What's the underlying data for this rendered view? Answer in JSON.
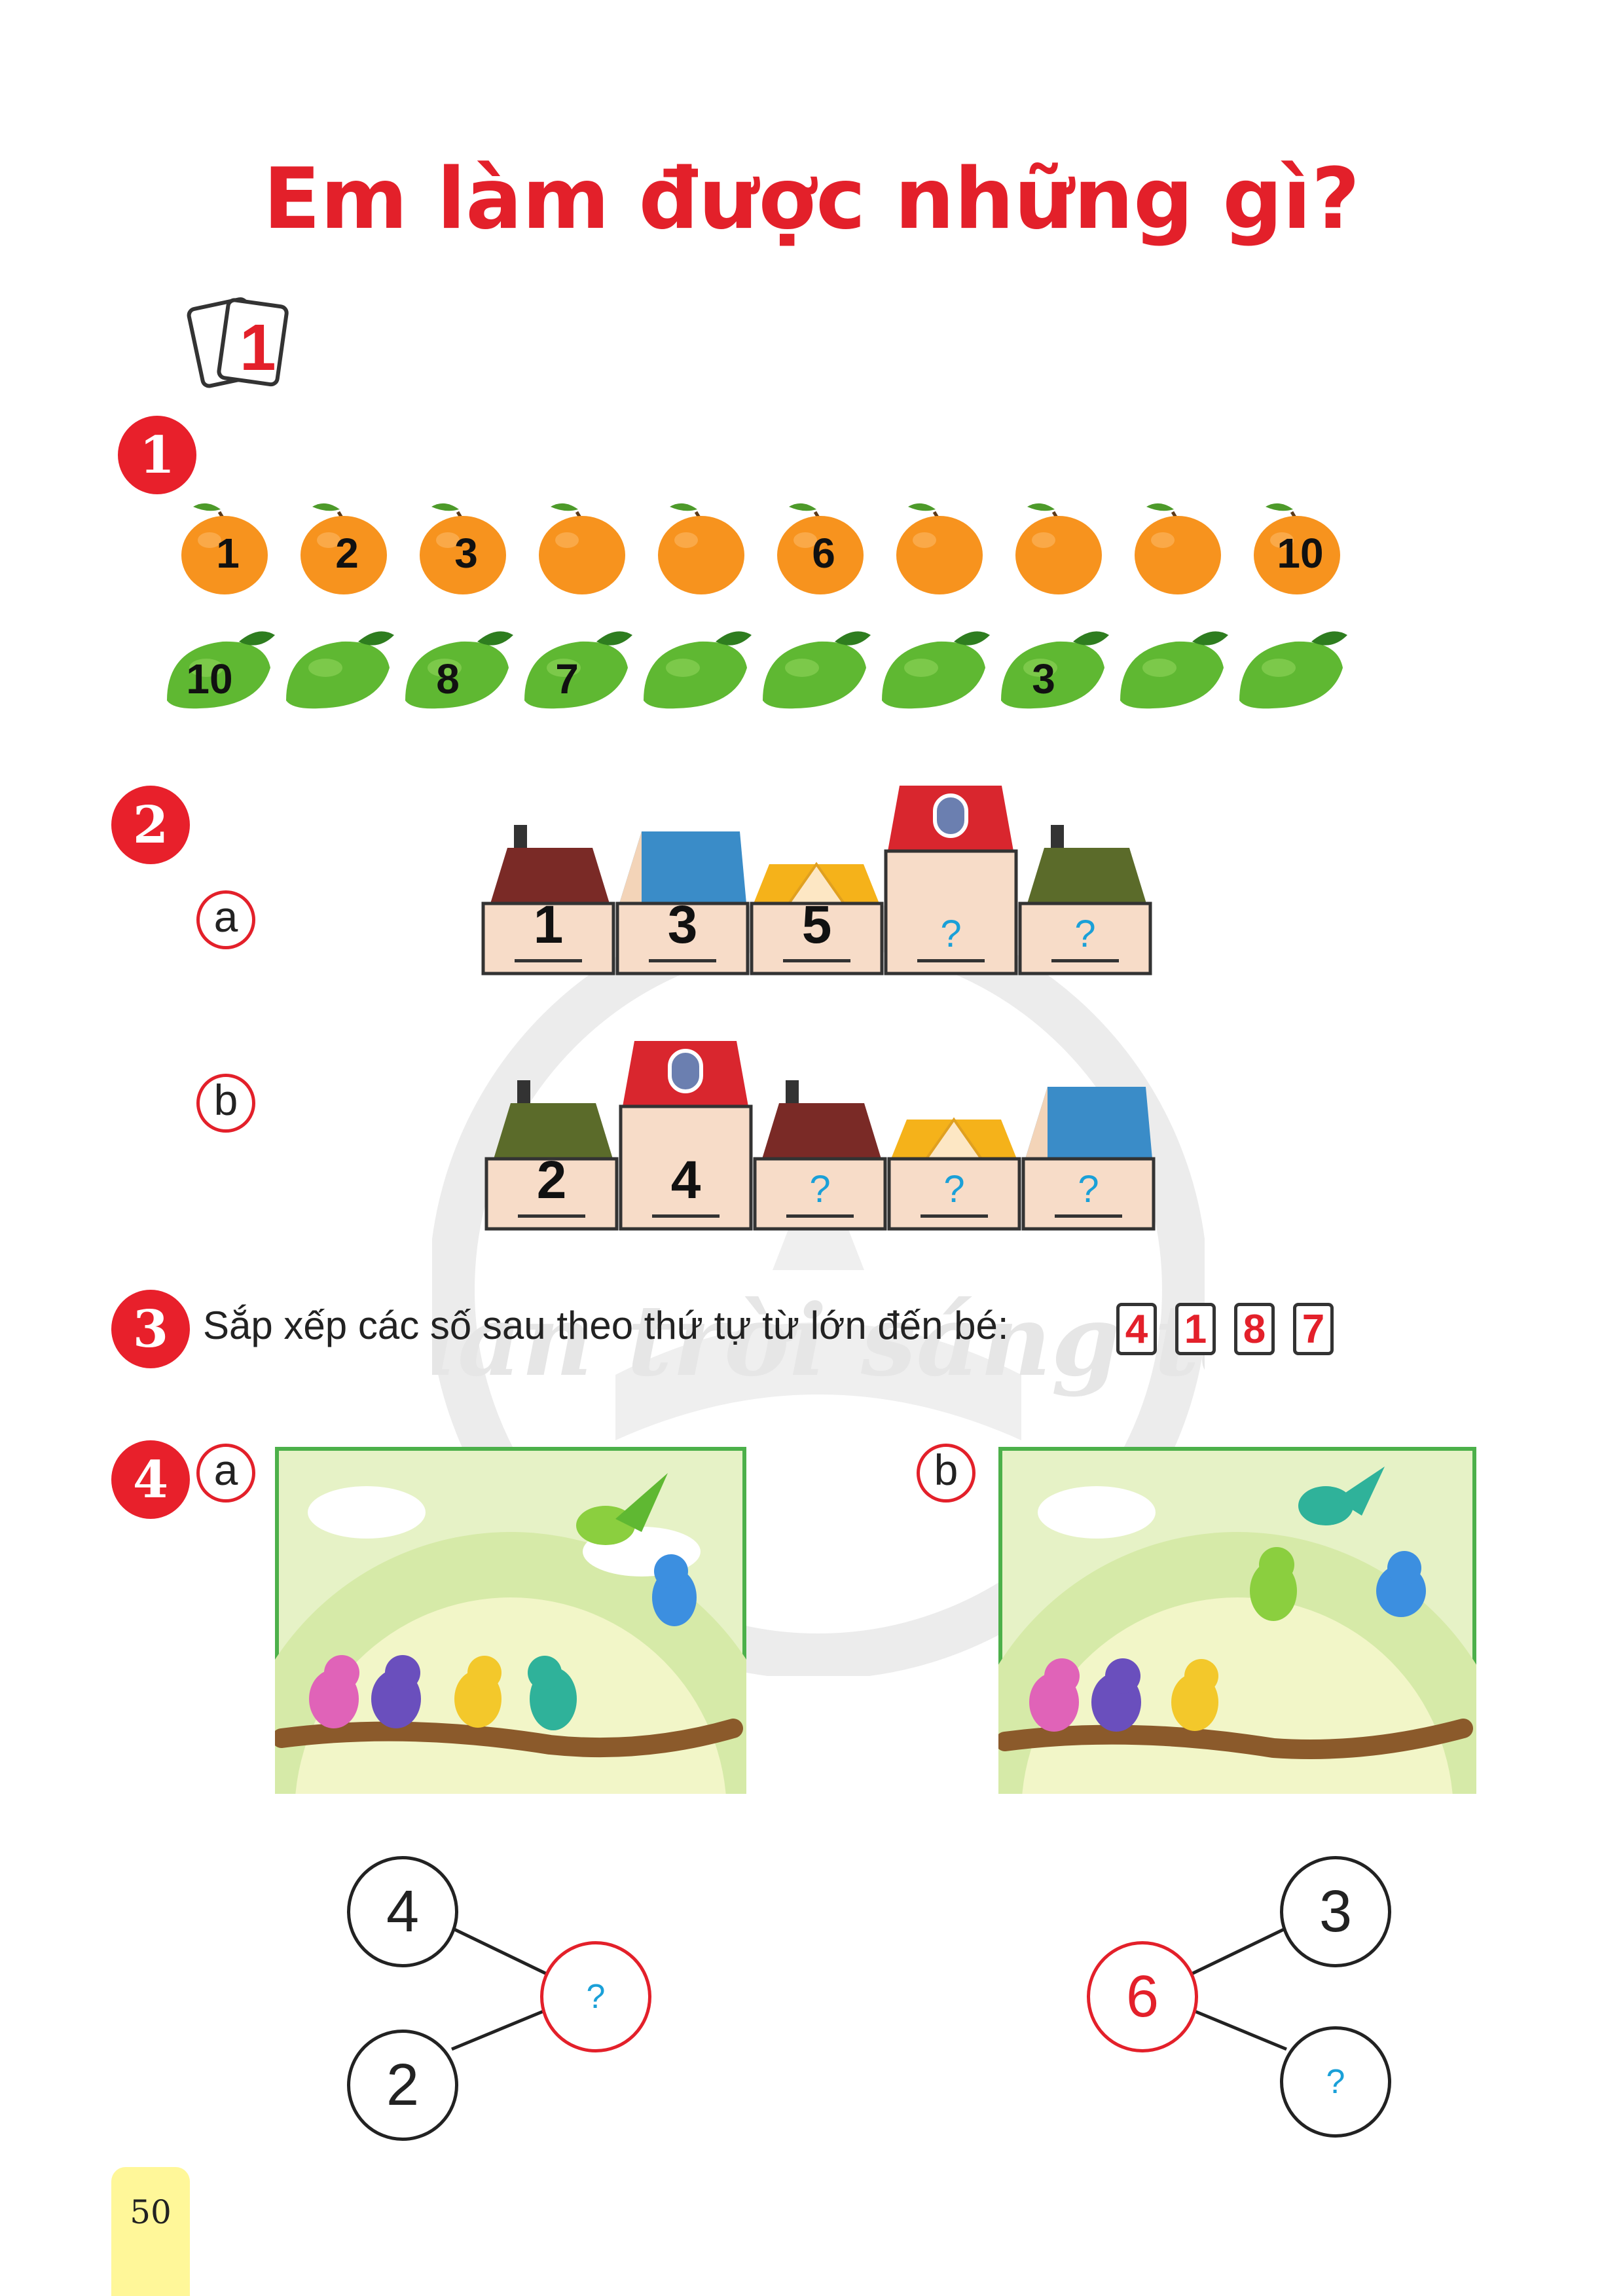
{
  "title": "Em làm được những gì?",
  "cards_icon_number": "1",
  "exercise1": {
    "number": "1",
    "oranges": [
      "1",
      "2",
      "3",
      "",
      "",
      "6",
      "",
      "",
      "",
      "10"
    ],
    "mangoes": [
      "10",
      "",
      "8",
      "7",
      "",
      "",
      "",
      "3",
      "",
      ""
    ]
  },
  "exercise2": {
    "number": "2",
    "a": {
      "label": "a",
      "houses": [
        "1",
        "3",
        "5",
        "?",
        "?"
      ]
    },
    "b": {
      "label": "b",
      "houses": [
        "2",
        "4",
        "?",
        "?",
        "?"
      ]
    }
  },
  "exercise3": {
    "number": "3",
    "text": "Sắp xếp các số sau theo thứ tự từ lớn đến bé:",
    "numbers": [
      "4",
      "1",
      "8",
      "7"
    ]
  },
  "exercise4": {
    "number": "4",
    "a": {
      "label": "a",
      "top": "4",
      "bottom": "2",
      "total": "?"
    },
    "b": {
      "label": "b",
      "total": "6",
      "top": "3",
      "bottom": "?"
    }
  },
  "watermark_text": "Chan trời sáng tạo",
  "page_number": "50",
  "colors": {
    "accent_red": "#e3202a",
    "orange": "#f7931e",
    "mango_green": "#5fb832",
    "frame_green": "#4cb04a",
    "question_blue": "#1aa0d8"
  }
}
